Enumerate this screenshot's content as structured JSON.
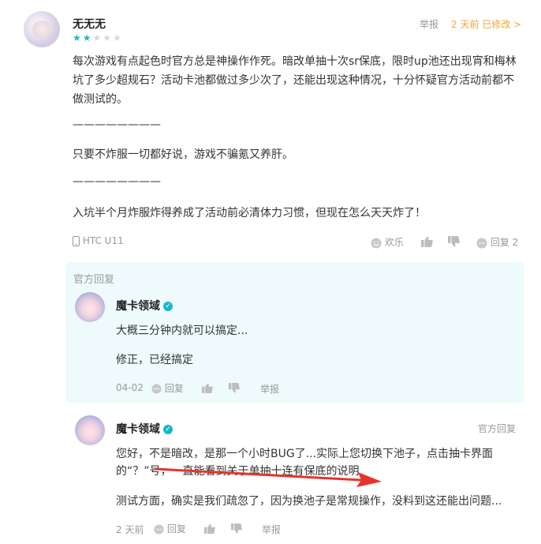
{
  "review": {
    "username": "无无无",
    "rating": 2,
    "rating_max": 5,
    "report_label": "举报",
    "time_edit_label": "2 天前 已修改 >",
    "paragraphs": [
      "每次游戏有点起色时官方总是神操作作死。暗改单抽十次sr保底，限时up池还出现宵和梅林",
      "坑了多少超规石？活动卡池都做过多少次了，还能出现这种情况，十分怀疑官方活动前都不",
      "做测试的。",
      "————————",
      "只要不炸服一切都好说，游戏不骗氪又养肝。",
      "————————",
      "入坑半个月炸服炸得养成了活动前必清体力习惯，但现在怎么天天炸了！"
    ],
    "device": "HTC U11",
    "reaction_label": "欢乐",
    "reply_label": "回复 2"
  },
  "official_reply": {
    "header": "官方回复",
    "name": "魔卡领域",
    "lines": [
      "大概三分钟内就可以搞定...",
      "修正，已经搞定"
    ],
    "date": "04-02",
    "reply_label": "回复",
    "report_label": "举报"
  },
  "dev_reply": {
    "name": "魔卡领域",
    "tag": "官方回复",
    "lines": [
      "您好，不是暗改，是那一个小时BUG了...实际上您切换下池子，点击抽卡界面",
      "的“？”号，一直能看到关于单抽十连有保底的说明",
      "测试方面，确实是我们疏忽了，因为换池子是常规操作，没料到这还能出问题..."
    ],
    "time": "2 天前",
    "reply_label": "回复",
    "report_label": "举报"
  },
  "colors": {
    "accent": "#14b9c8",
    "edit_orange": "#f5a623",
    "reply_bg": "#eefafb",
    "annotation_red": "#e8322c"
  }
}
